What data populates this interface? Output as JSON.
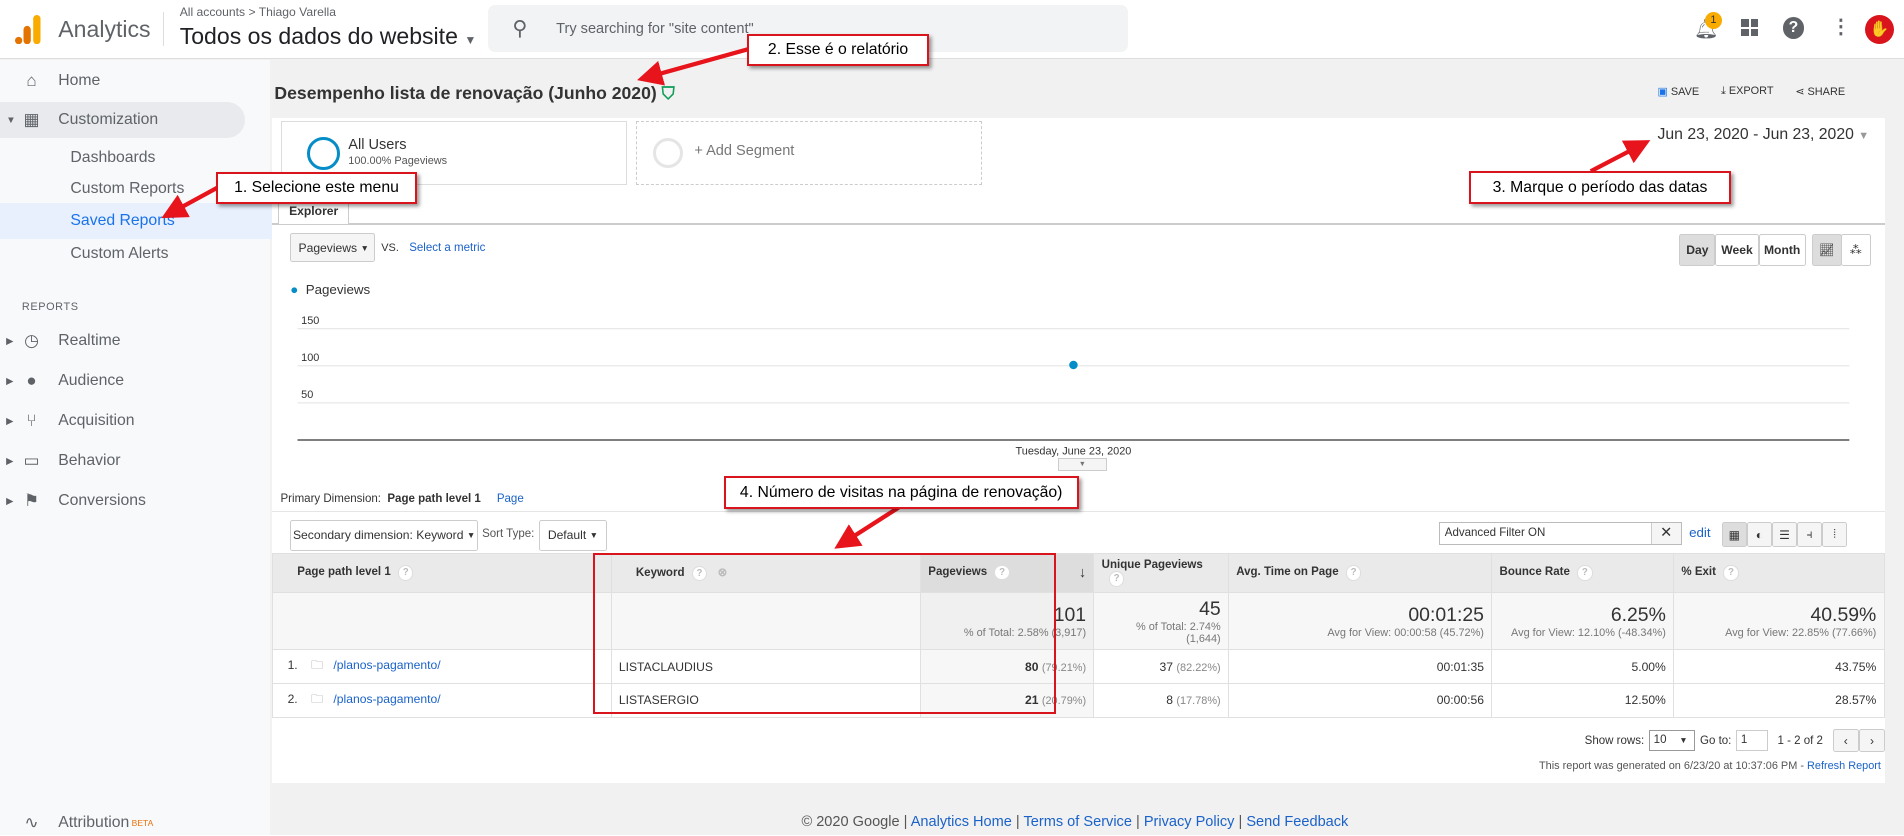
{
  "header": {
    "app_name": "Analytics",
    "breadcrumb_account": "All accounts",
    "breadcrumb_sep": ">",
    "breadcrumb_property": "Thiago Varella",
    "view_name": "Todos os dados do website",
    "search_placeholder": "Try searching for \"site content\"",
    "notification_count": "1"
  },
  "sidebar": {
    "home": "Home",
    "customization": "Customization",
    "sub_items": [
      "Dashboards",
      "Custom Reports",
      "Saved Reports",
      "Custom Alerts"
    ],
    "reports_heading": "REPORTS",
    "reports": [
      "Realtime",
      "Audience",
      "Acquisition",
      "Behavior",
      "Conversions"
    ],
    "attribution": "Attribution",
    "attribution_badge": "BETA"
  },
  "report": {
    "title": "Desempenho lista de renovação (Junho 2020)",
    "save": "SAVE",
    "export": "EXPORT",
    "share": "SHARE",
    "segment_name": "All Users",
    "segment_sub": "100.00% Pageviews",
    "add_segment": "+ Add Segment",
    "date_range": "Jun 23, 2020 - Jun 23, 2020",
    "tab": "Explorer",
    "metric": "Pageviews",
    "vs": "VS.",
    "select_metric": "Select a metric",
    "periods": [
      "Day",
      "Week",
      "Month"
    ]
  },
  "chart_data": {
    "type": "scatter",
    "series": [
      {
        "name": "Pageviews",
        "x": [
          "Tuesday, June 23, 2020"
        ],
        "values": [
          101
        ]
      }
    ],
    "yticks": [
      "150",
      "100",
      "50"
    ],
    "ylim": [
      0,
      175
    ],
    "xlabel": "Tuesday, June 23, 2020",
    "color": "#058dc7"
  },
  "dimensions": {
    "label": "Primary Dimension:",
    "active": "Page path level 1",
    "other": "Page",
    "secondary": "Secondary dimension: Keyword",
    "sort_label": "Sort Type:",
    "sort_value": "Default",
    "filter_value": "Advanced Filter ON",
    "edit": "edit"
  },
  "table": {
    "headers": [
      "Page path level 1",
      "Keyword",
      "Pageviews",
      "Unique Pageviews",
      "Avg. Time on Page",
      "Bounce Rate",
      "% Exit"
    ],
    "totals": [
      {
        "value": "101",
        "sub": "% of Total: 2.58% (3,917)"
      },
      {
        "value": "45",
        "sub": "% of Total: 2.74% (1,644)"
      },
      {
        "value": "00:01:25",
        "sub": "Avg for View: 00:00:58 (45.72%)"
      },
      {
        "value": "6.25%",
        "sub": "Avg for View: 12.10% (-48.34%)"
      },
      {
        "value": "40.59%",
        "sub": "Avg for View: 22.85% (77.66%)"
      }
    ],
    "rows": [
      {
        "index": "1.",
        "page": "/planos-pagamento/",
        "keyword": "LISTACLAUDIUS",
        "pageviews": "80",
        "pageviews_pct": "(79.21%)",
        "unique": "37",
        "unique_pct": "(82.22%)",
        "avg_time": "00:01:35",
        "bounce": "5.00%",
        "exit": "43.75%"
      },
      {
        "index": "2.",
        "page": "/planos-pagamento/",
        "keyword": "LISTASERGIO",
        "pageviews": "21",
        "pageviews_pct": "(20.79%)",
        "unique": "8",
        "unique_pct": "(17.78%)",
        "avg_time": "00:00:56",
        "bounce": "12.50%",
        "exit": "28.57%"
      }
    ],
    "show_rows_label": "Show rows:",
    "show_rows": "10",
    "goto_label": "Go to:",
    "goto": "1",
    "range": "1 - 2 of 2",
    "generated": "This report was generated on 6/23/20 at 10:37:06 PM - ",
    "refresh": "Refresh Report"
  },
  "footer": {
    "copyright": "© 2020 Google |",
    "links": [
      "Analytics Home",
      "Terms of Service",
      "Privacy Policy",
      "Send Feedback"
    ]
  },
  "annotations": [
    "1. Selecione este menu",
    "2. Esse é o relatório",
    "3. Marque o período das datas",
    "4. Número de visitas na página de renovação)"
  ]
}
